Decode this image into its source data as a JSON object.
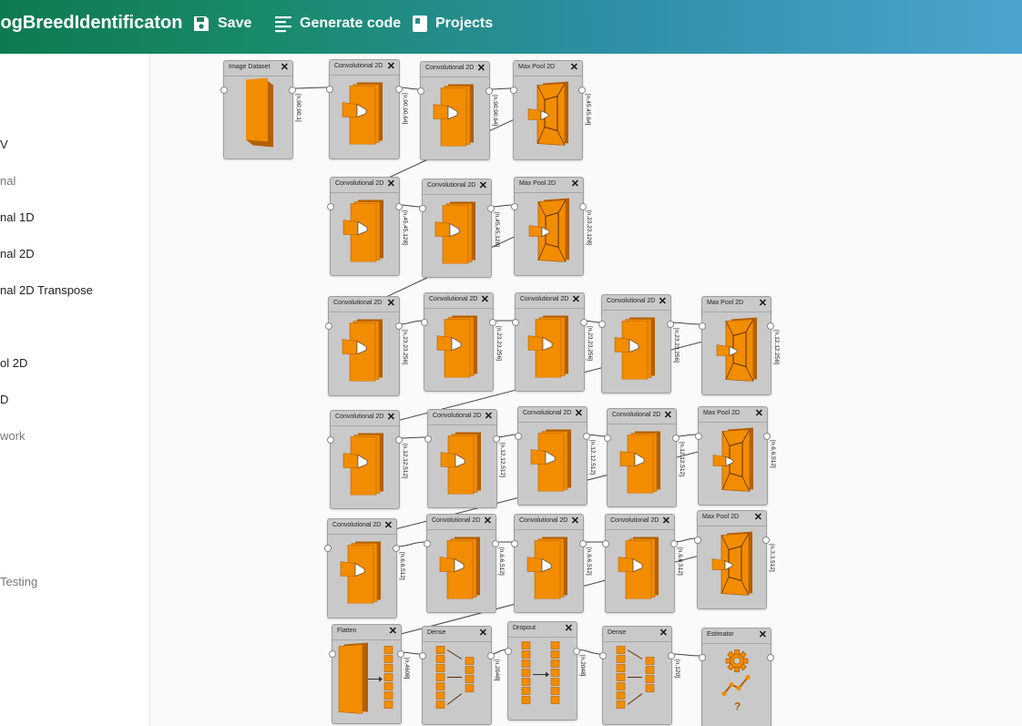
{
  "app": {
    "title": "DogBreedIdentificaton"
  },
  "toolbar": {
    "save": {
      "label": "Save",
      "icon": "save-icon"
    },
    "generate": {
      "label": "Generate code",
      "icon": "code-lines-icon"
    },
    "projects": {
      "label": "Projects",
      "icon": "projects-icon"
    }
  },
  "sidebar": {
    "items": [
      {
        "label": "V",
        "category": false
      },
      {
        "label": "nal",
        "category": true
      },
      {
        "label": "nal 1D",
        "category": false
      },
      {
        "label": "nal 2D",
        "category": false
      },
      {
        "label": "nal 2D Transpose",
        "category": false
      },
      {
        "label": "ol 2D",
        "category": false
      },
      {
        "label": "D",
        "category": false
      },
      {
        "label": "work",
        "category": true
      },
      {
        "label": "Testing",
        "category": true
      }
    ]
  },
  "nodes": [
    {
      "id": "image-dataset",
      "title": "Image Dataset",
      "icon": "book-icon",
      "shape": "[n,90,90,1]"
    },
    {
      "id": "conv-1",
      "title": "Convolutional 2D",
      "icon": "conv-icon",
      "shape": "[n,90,90,64]"
    },
    {
      "id": "conv-2",
      "title": "Convolutional 2D",
      "icon": "conv-icon",
      "shape": "[n,90,90,64]"
    },
    {
      "id": "pool-1",
      "title": "Max Pool 2D",
      "icon": "pool-icon",
      "shape": "[n,45,45,64]"
    },
    {
      "id": "conv-3",
      "title": "Convolutional 2D",
      "icon": "conv-icon",
      "shape": "[n,45,45,128]"
    },
    {
      "id": "conv-4",
      "title": "Convolutional 2D",
      "icon": "conv-icon",
      "shape": "[n,45,45,128]"
    },
    {
      "id": "pool-2",
      "title": "Max Pool 2D",
      "icon": "pool-icon",
      "shape": "[n,23,23,128]"
    },
    {
      "id": "conv-5",
      "title": "Convolutional 2D",
      "icon": "conv-icon",
      "shape": "[n,23,23,256]"
    },
    {
      "id": "conv-6",
      "title": "Convolutional 2D",
      "icon": "conv-icon",
      "shape": "[n,23,23,256]"
    },
    {
      "id": "conv-7",
      "title": "Convolutional 2D",
      "icon": "conv-icon",
      "shape": "[n,23,23,256]"
    },
    {
      "id": "conv-8",
      "title": "Convolutional 2D",
      "icon": "conv-icon",
      "shape": "[n,23,23,256]"
    },
    {
      "id": "pool-3",
      "title": "Max Pool 2D",
      "icon": "pool-icon",
      "shape": "[n,12,12,256]"
    },
    {
      "id": "conv-9",
      "title": "Convolutional 2D",
      "icon": "conv-icon",
      "shape": "[n,12,12,512]"
    },
    {
      "id": "conv-10",
      "title": "Convolutional 2D",
      "icon": "conv-icon",
      "shape": "[n,12,12,512]"
    },
    {
      "id": "conv-11",
      "title": "Convolutional 2D",
      "icon": "conv-icon",
      "shape": "[n,12,12,512]"
    },
    {
      "id": "conv-12",
      "title": "Convolutional 2D",
      "icon": "conv-icon",
      "shape": "[n,12,12,512]"
    },
    {
      "id": "pool-4",
      "title": "Max Pool 2D",
      "icon": "pool-icon",
      "shape": "[n,6,6,512]"
    },
    {
      "id": "conv-13",
      "title": "Convolutional 2D",
      "icon": "conv-icon",
      "shape": "[n,6,6,512]"
    },
    {
      "id": "conv-14",
      "title": "Convolutional 2D",
      "icon": "conv-icon",
      "shape": "[n,6,6,512]"
    },
    {
      "id": "conv-15",
      "title": "Convolutional 2D",
      "icon": "conv-icon",
      "shape": "[n,6,6,512]"
    },
    {
      "id": "conv-16",
      "title": "Convolutional 2D",
      "icon": "conv-icon",
      "shape": "[n,6,6,512]"
    },
    {
      "id": "pool-5",
      "title": "Max Pool 2D",
      "icon": "pool-icon",
      "shape": "[n,3,3,512]"
    },
    {
      "id": "flatten",
      "title": "Flatten",
      "icon": "flatten-icon",
      "shape": "[n,4608]"
    },
    {
      "id": "dense-1",
      "title": "Dense",
      "icon": "dense-icon",
      "shape": "[n,2048]"
    },
    {
      "id": "dropout",
      "title": "Dropout",
      "icon": "dropout-icon",
      "shape": "[n,2048]"
    },
    {
      "id": "dense-2",
      "title": "Dense",
      "icon": "dense-icon",
      "shape": "[n,120]"
    },
    {
      "id": "estimator",
      "title": "Estimator",
      "icon": "estimator-icon",
      "shape": ""
    }
  ],
  "colors": {
    "accent": "#f28c00",
    "accentDark": "#b35f00",
    "nodeBg": "#c9c9c9",
    "wire": "#444444"
  }
}
